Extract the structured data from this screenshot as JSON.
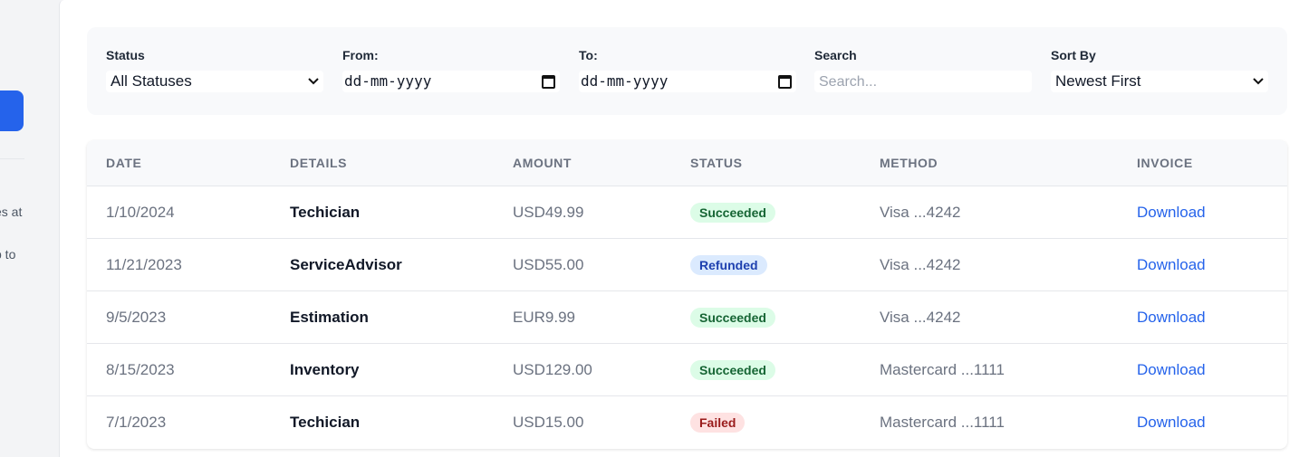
{
  "sidebar": {
    "text1": "es at",
    "text2": "p to"
  },
  "filters": {
    "status": {
      "label": "Status",
      "value": "All Statuses"
    },
    "from": {
      "label": "From:",
      "placeholder": "dd-mm-yyyy"
    },
    "to": {
      "label": "To:",
      "placeholder": "dd-mm-yyyy"
    },
    "search": {
      "label": "Search",
      "placeholder": "Search..."
    },
    "sort": {
      "label": "Sort By",
      "value": "Newest First"
    }
  },
  "table": {
    "headers": [
      "DATE",
      "DETAILS",
      "AMOUNT",
      "STATUS",
      "METHOD",
      "INVOICE"
    ],
    "rows": [
      {
        "date": "1/10/2024",
        "details": "Techician",
        "amount": "USD49.99",
        "status": "Succeeded",
        "status_type": "succeeded",
        "method": "Visa ...4242",
        "invoice": "Download"
      },
      {
        "date": "11/21/2023",
        "details": "ServiceAdvisor",
        "amount": "USD55.00",
        "status": "Refunded",
        "status_type": "refunded",
        "method": "Visa ...4242",
        "invoice": "Download"
      },
      {
        "date": "9/5/2023",
        "details": "Estimation",
        "amount": "EUR9.99",
        "status": "Succeeded",
        "status_type": "succeeded",
        "method": "Visa ...4242",
        "invoice": "Download"
      },
      {
        "date": "8/15/2023",
        "details": "Inventory",
        "amount": "USD129.00",
        "status": "Succeeded",
        "status_type": "succeeded",
        "method": "Mastercard ...1111",
        "invoice": "Download"
      },
      {
        "date": "7/1/2023",
        "details": "Techician",
        "amount": "USD15.00",
        "status": "Failed",
        "status_type": "failed",
        "method": "Mastercard ...1111",
        "invoice": "Download"
      }
    ]
  },
  "colors": {
    "accent": "#2563eb",
    "succeeded_bg": "#dcfce7",
    "refunded_bg": "#dbeafe",
    "failed_bg": "#fee2e2"
  }
}
